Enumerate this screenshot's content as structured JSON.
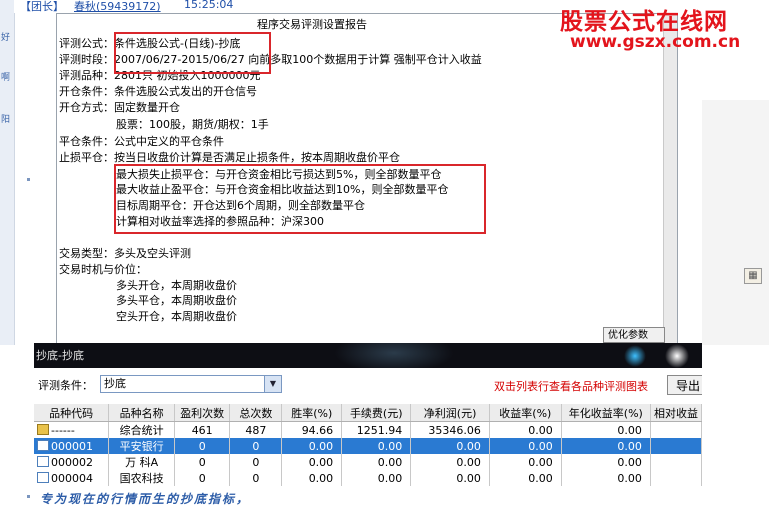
{
  "chat": {
    "group_tag": "【团长】",
    "user": "春秋(59439172)",
    "time": "15:25:04"
  },
  "left_strip": [
    "好",
    "啊",
    "阳"
  ],
  "brand": {
    "title": "股票公式在线网",
    "url": "www.gszx.com.cn",
    "color": "#e3141c"
  },
  "report": {
    "title": "程序交易评测设置报告",
    "lines": [
      "评测公式：条件选股公式-(日线)-抄底",
      "评测时段：2007/06/27-2015/06/27 向前多取100个数据用于计算 强制平仓计入收益",
      "评测品种：2801只  初始投入1000000元",
      "开仓条件：条件选股公式发出的开仓信号",
      "开仓方式：固定数量开仓",
      "股票：100股，期货/期权：1手",
      "平仓条件：公式中定义的平仓条件",
      "止损平仓：按当日收盘价计算是否满足止损条件，按本周期收盘价平仓",
      "最大损失止损平仓：与开仓资金相比亏损达到5%，则全部数量平仓",
      "最大收益止盈平仓：与开仓资金相比收益达到10%，则全部数量平仓",
      "目标周期平仓：开仓达到6个周期，则全部数量平仓",
      "计算相对收益率选择的参照品种：沪深300",
      "交易类型：多头及空头评测",
      "交易时机与价位：",
      "多头开仓，本周期收盘价",
      "多头平仓，本周期收盘价",
      "空头开仓，本周期收盘价"
    ],
    "partial_button": "优化参数"
  },
  "toolbar": {
    "title": "抄底-抄底"
  },
  "eval": {
    "label": "评测条件：",
    "select_value": "抄底",
    "hint": "双击列表行查看各品种评测图表",
    "export": "导出",
    "columns": [
      "品种代码",
      "品种名称",
      "盈利次数",
      "总次数",
      "胜率(%)",
      "手续费(元)",
      "净利润(元)",
      "收益率(%)",
      "年化收益率(%)",
      "相对收益"
    ],
    "rows": [
      [
        "------",
        "综合统计",
        "461",
        "487",
        "94.66",
        "1251.94",
        "35346.06",
        "0.00",
        "0.00",
        ""
      ],
      [
        "000001",
        "平安银行",
        "0",
        "0",
        "0.00",
        "0.00",
        "0.00",
        "0.00",
        "0.00",
        ""
      ],
      [
        "000002",
        "万  科A",
        "0",
        "0",
        "0.00",
        "0.00",
        "0.00",
        "0.00",
        "0.00",
        ""
      ],
      [
        "000004",
        "国农科技",
        "0",
        "0",
        "0.00",
        "0.00",
        "0.00",
        "0.00",
        "0.00",
        ""
      ]
    ],
    "row_icons": [
      "folder-icon",
      "document-icon",
      "document-icon",
      "document-icon"
    ]
  },
  "slogan": "专为现在的行情而生的抄底指标，",
  "colors": {
    "highlight_box": "#d9262b",
    "selected_row": "#2a7ad2",
    "hint_text": "#d40000"
  }
}
